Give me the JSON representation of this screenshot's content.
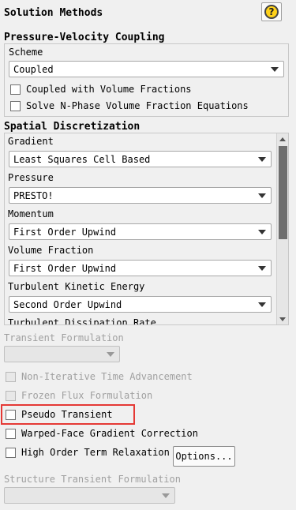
{
  "header": {
    "title": "Solution Methods",
    "help_glyph": "?"
  },
  "pv_coupling": {
    "header": "Pressure-Velocity Coupling",
    "scheme_label": "Scheme",
    "scheme_value": "Coupled",
    "coupled_vf_label": "Coupled with Volume Fractions",
    "solve_nphase_label": "Solve N-Phase Volume Fraction Equations"
  },
  "spatial": {
    "header": "Spatial Discretization",
    "items": [
      {
        "label": "Gradient",
        "value": "Least Squares Cell Based"
      },
      {
        "label": "Pressure",
        "value": "PRESTO!"
      },
      {
        "label": "Momentum",
        "value": "First Order Upwind"
      },
      {
        "label": "Volume Fraction",
        "value": "First Order Upwind"
      },
      {
        "label": "Turbulent Kinetic Energy",
        "value": "Second Order Upwind"
      },
      {
        "label": "Turbulent Dissipation Rate",
        "value": ""
      }
    ]
  },
  "transient": {
    "label": "Transient Formulation",
    "value": "",
    "non_iterative_label": "Non-Iterative Time Advancement",
    "frozen_flux_label": "Frozen Flux Formulation",
    "pseudo_transient_label": "Pseudo Transient",
    "warped_face_label": "Warped-Face Gradient Correction",
    "high_order_label": "High Order Term Relaxation",
    "options_button": "Options...",
    "structure_label": "Structure Transient Formulation",
    "structure_value": ""
  },
  "colors": {
    "highlight": "#e53935",
    "thumb": "#6e6e6e"
  }
}
